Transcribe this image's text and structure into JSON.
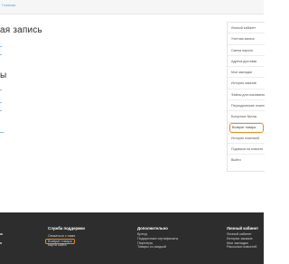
{
  "header": {
    "breadcrumb": "Главная"
  },
  "main": {
    "title": "ая запись",
    "section_title": "ы"
  },
  "sidebar": {
    "items": [
      {
        "label": "Личный кабинет"
      },
      {
        "label": "Учетная запись"
      },
      {
        "label": "Смена пароля"
      },
      {
        "label": "Адреса доставки"
      },
      {
        "label": "Мои закладки"
      },
      {
        "label": "История заказов"
      },
      {
        "label": "Файлы для скачивания"
      },
      {
        "label": "Периодические платежи"
      },
      {
        "label": "Бонусные баллы"
      },
      {
        "label": "Возврат товара",
        "active": true
      },
      {
        "label": "История платежей"
      },
      {
        "label": "Подписка на новости"
      },
      {
        "label": "Выйти"
      }
    ]
  },
  "footer": {
    "support": {
      "title": "Служба поддержки",
      "links": [
        "Связаться с нами",
        "Возврат товара",
        "Карта сайта"
      ]
    },
    "extra": {
      "title": "Дополнительно",
      "links": [
        "Бренд",
        "Подарочные сертификаты",
        "Партнеры",
        "Товары со скидкой"
      ]
    },
    "account": {
      "title": "Личный кабинет",
      "links": [
        "Личный кабинет",
        "История заказов",
        "Мои закладки",
        "Рассылка новостей"
      ]
    }
  },
  "colors": {
    "accent": "#f08a1c",
    "footer_bg": "#2d2d2d",
    "link": "#6a9fd0"
  }
}
